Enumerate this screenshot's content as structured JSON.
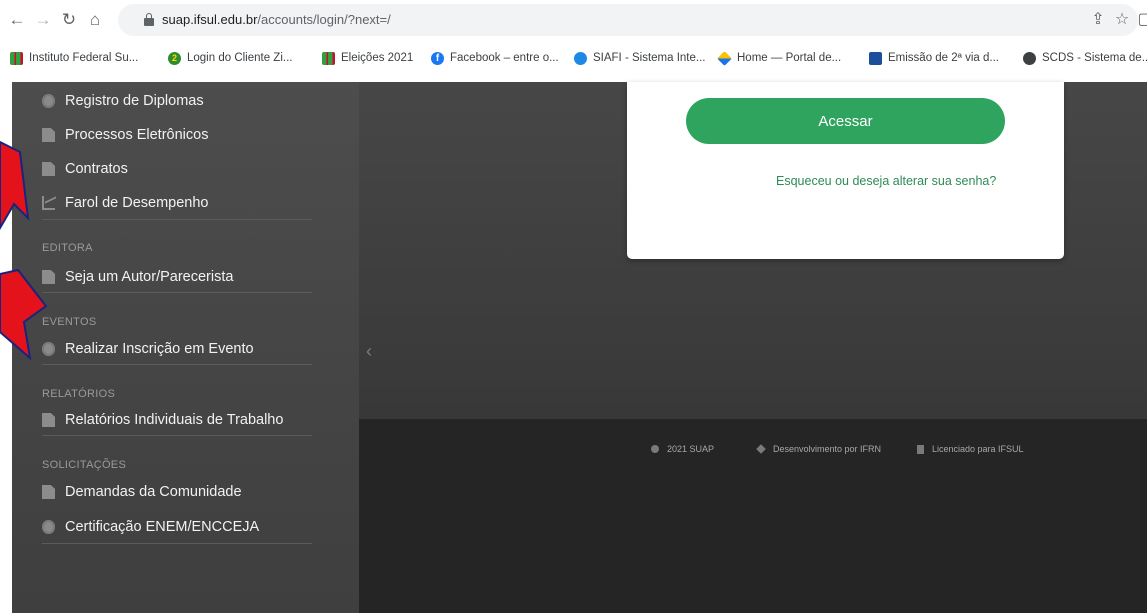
{
  "browser": {
    "url_host": "suap.ifsul.edu.br",
    "url_path": "/accounts/login/?next=/",
    "bookmarks": [
      {
        "label": "Instituto Federal Su...",
        "icon": "ifsul-logo-icon"
      },
      {
        "label": "Login do Cliente Zi...",
        "icon": "zi-logo-icon"
      },
      {
        "label": "Eleições 2021",
        "icon": "ifsul-logo-icon"
      },
      {
        "label": "Facebook – entre o...",
        "icon": "facebook-icon"
      },
      {
        "label": "SIAFI - Sistema Inte...",
        "icon": "siafi-icon"
      },
      {
        "label": "Home — Portal de...",
        "icon": "gov-portal-icon"
      },
      {
        "label": "Emissão de 2ª via d...",
        "icon": "emissao-icon"
      },
      {
        "label": "SCDS - Sistema de...",
        "icon": "globe-icon"
      }
    ]
  },
  "sidebar": {
    "top_items": [
      {
        "label": "Registro de Diplomas",
        "icon": "gear-icon"
      },
      {
        "label": "Processos Eletrônicos",
        "icon": "document-icon"
      },
      {
        "label": "Contratos",
        "icon": "document-icon"
      },
      {
        "label": "Farol de Desempenho",
        "icon": "chart-icon"
      }
    ],
    "sections": [
      {
        "title": "EDITORA",
        "items": [
          {
            "label": "Seja um Autor/Parecerista",
            "icon": "document-icon"
          }
        ]
      },
      {
        "title": "EVENTOS",
        "items": [
          {
            "label": "Realizar Inscrição em Evento",
            "icon": "gear-icon"
          }
        ]
      },
      {
        "title": "RELATÓRIOS",
        "items": [
          {
            "label": "Relatórios Individuais de Trabalho",
            "icon": "document-icon"
          }
        ]
      },
      {
        "title": "SOLICITAÇÕES",
        "items": [
          {
            "label": "Demandas da Comunidade",
            "icon": "document-icon"
          },
          {
            "label": "Certificação ENEM/ENCCEJA",
            "icon": "gear-icon"
          }
        ]
      }
    ]
  },
  "login": {
    "submit_label": "Acessar",
    "forgot_label": "Esqueceu ou deseja alterar sua senha?"
  },
  "footer": {
    "copyright": "2021 SUAP",
    "developer": "Desenvolvimento por IFRN",
    "license": "Licenciado para IFSUL"
  },
  "colors": {
    "accent_green": "#2ea45e",
    "link_green": "#2e8b57",
    "arrow_red": "#e4131b",
    "arrow_outline": "#1a237e"
  }
}
